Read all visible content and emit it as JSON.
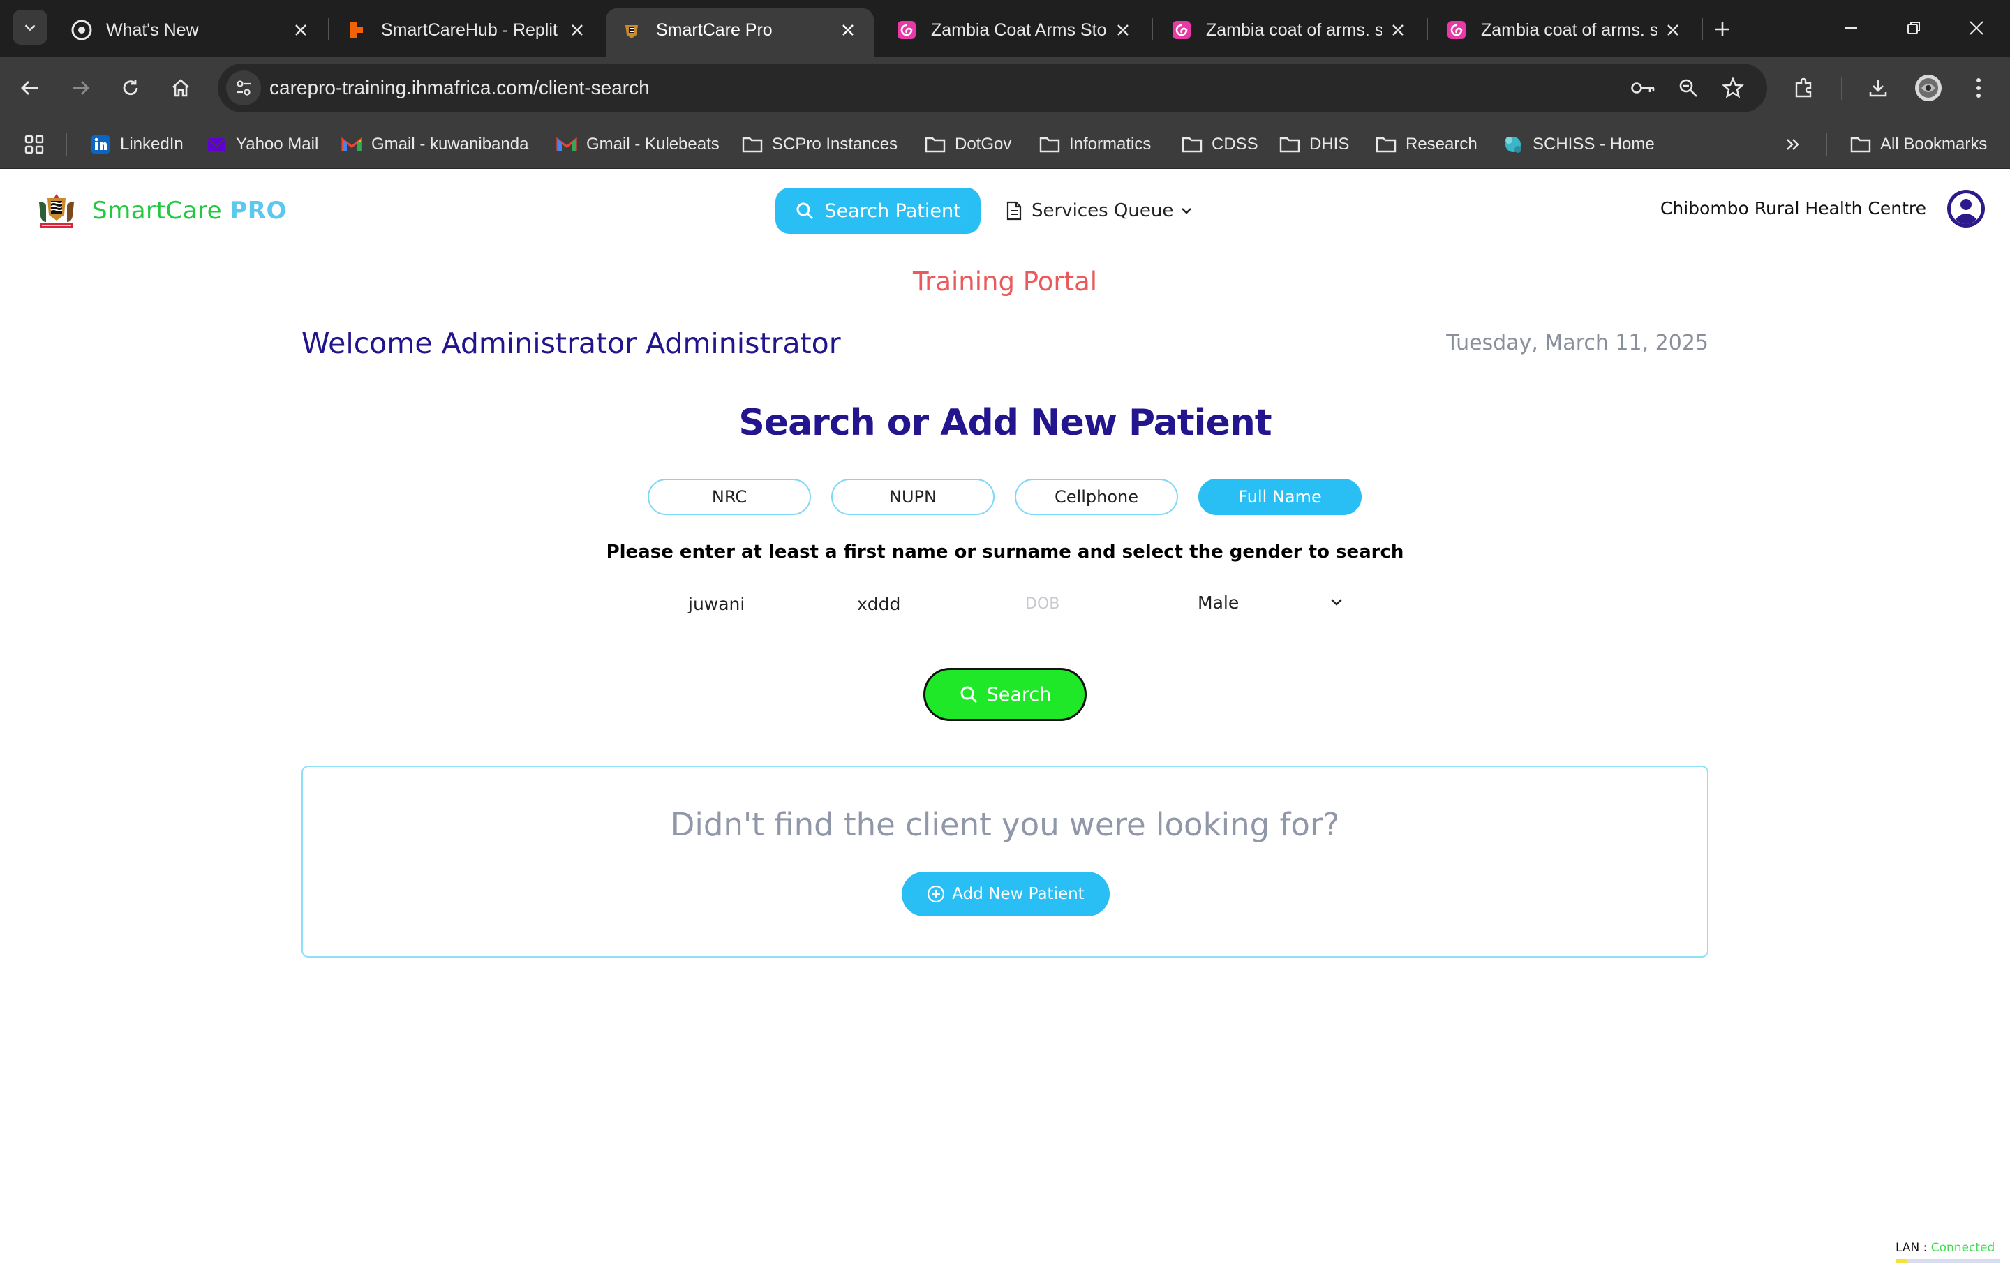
{
  "browser": {
    "tabs": [
      {
        "title": "What's New",
        "favicon": "chrome-icon",
        "active": false
      },
      {
        "title": "SmartCareHub - Replit",
        "favicon": "replit-icon",
        "active": false
      },
      {
        "title": "SmartCare Pro",
        "favicon": "zambia-coat-of-arms-icon",
        "active": true
      },
      {
        "title": "Zambia Coat Arms Stock",
        "favicon": "pink-swirl-icon",
        "active": false
      },
      {
        "title": "Zambia coat of arms. st",
        "favicon": "pink-swirl-icon",
        "active": false
      },
      {
        "title": "Zambia coat of arms. st",
        "favicon": "pink-swirl-icon",
        "active": false
      }
    ],
    "url": "carepro-training.ihmafrica.com/client-search",
    "bookmarks": [
      {
        "label": "LinkedIn",
        "icon": "linkedin-icon"
      },
      {
        "label": "Yahoo Mail",
        "icon": "yahoo-mail-icon"
      },
      {
        "label": "Gmail - kuwanibanda",
        "icon": "gmail-icon"
      },
      {
        "label": "Gmail - Kulebeats",
        "icon": "gmail-icon"
      },
      {
        "label": "SCPro Instances",
        "icon": "folder-icon"
      },
      {
        "label": "DotGov",
        "icon": "folder-icon"
      },
      {
        "label": "Informatics",
        "icon": "folder-icon"
      },
      {
        "label": "CDSS",
        "icon": "folder-icon"
      },
      {
        "label": "DHIS",
        "icon": "folder-icon"
      },
      {
        "label": "Research",
        "icon": "folder-icon"
      },
      {
        "label": "SCHISS - Home",
        "icon": "schiss-icon"
      }
    ],
    "all_bookmarks_label": "All Bookmarks"
  },
  "app": {
    "brand_main": "SmartCare",
    "brand_accent": "PRO",
    "nav": {
      "search_patient": "Search Patient",
      "services_queue": "Services Queue"
    },
    "facility": "Chibombo Rural Health Centre",
    "training_banner": "Training Portal",
    "welcome": "Welcome Administrator Administrator",
    "date": "Tuesday, March 11, 2025",
    "heading": "Search or Add New Patient",
    "search_types": [
      {
        "label": "NRC",
        "active": false
      },
      {
        "label": "NUPN",
        "active": false
      },
      {
        "label": "Cellphone",
        "active": false
      },
      {
        "label": "Full Name",
        "active": true
      }
    ],
    "instruction": "Please enter at least a first name or surname and select the gender to search",
    "form": {
      "first_name": "juwani",
      "surname": "xddd",
      "dob_placeholder": "DOB",
      "gender": "Male"
    },
    "search_button": "Search",
    "not_found": {
      "question": "Didn't find the client you were looking for?",
      "add_button": "Add New Patient"
    },
    "status": {
      "key": "LAN :",
      "value": "Connected"
    }
  },
  "colors": {
    "primary": "#29bff5",
    "navy": "#21148c",
    "search_green": "#1ee827",
    "training_red": "#ea5a5a"
  }
}
